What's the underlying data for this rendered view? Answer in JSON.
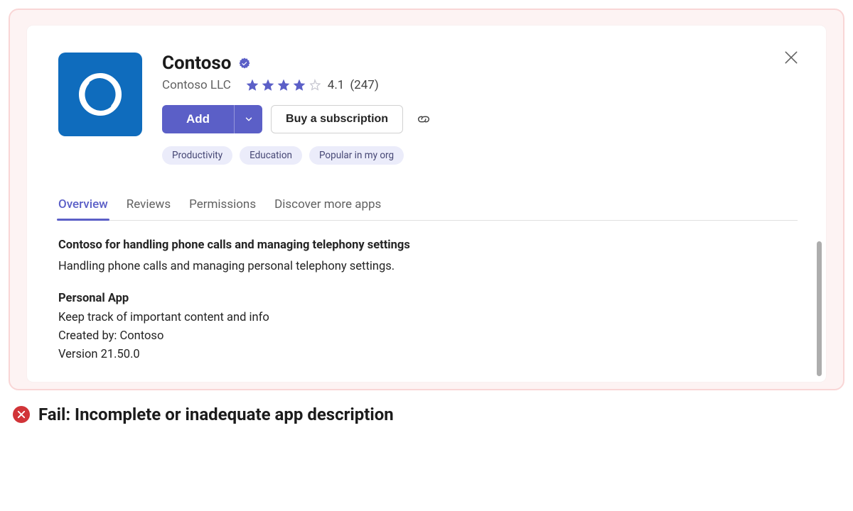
{
  "app": {
    "name": "Contoso",
    "publisher": "Contoso LLC",
    "rating": "4.1",
    "rating_count": "(247)"
  },
  "actions": {
    "add_label": "Add",
    "buy_label": "Buy a subscription"
  },
  "pills": [
    "Productivity",
    "Education",
    "Popular in my org"
  ],
  "tabs": [
    {
      "label": "Overview",
      "active": true
    },
    {
      "label": "Reviews",
      "active": false
    },
    {
      "label": "Permissions",
      "active": false
    },
    {
      "label": "Discover more apps",
      "active": false
    }
  ],
  "overview": {
    "headline": "Contoso for handling phone calls and managing telephony settings",
    "description": "Handling phone calls and managing personal telephony settings.",
    "section_title": "Personal App",
    "section_body": "Keep track of important content and info",
    "created_by_label": "Created by: Contoso",
    "version_label": "Version 21.50.0"
  },
  "verdict": {
    "text": "Fail: Incomplete or inadequate app description"
  }
}
